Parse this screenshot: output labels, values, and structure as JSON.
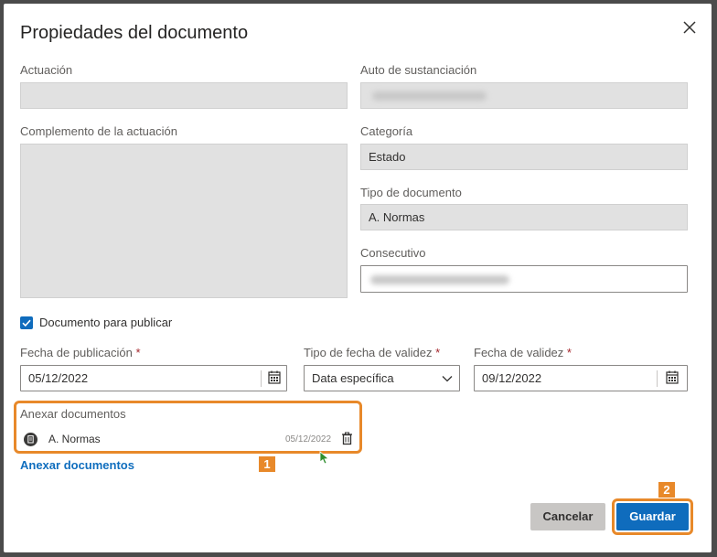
{
  "dialog": {
    "title": "Propiedades del documento"
  },
  "fields": {
    "actuacion": {
      "label": "Actuación",
      "value": ""
    },
    "auto": {
      "label": "Auto de sustanciación"
    },
    "complemento": {
      "label": "Complemento de la actuación",
      "value": ""
    },
    "categoria": {
      "label": "Categoría",
      "value": "Estado"
    },
    "tipo_documento": {
      "label": "Tipo de documento",
      "value": "A. Normas"
    },
    "consecutivo": {
      "label": "Consecutivo"
    }
  },
  "publicar": {
    "label": "Documento para publicar",
    "checked": true
  },
  "fecha_publicacion": {
    "label": "Fecha de publicación",
    "required_mark": "*",
    "value": "05/12/2022"
  },
  "tipo_fecha": {
    "label": "Tipo de fecha de validez",
    "required_mark": "*",
    "value": "Data específica"
  },
  "fecha_validez": {
    "label": "Fecha de validez",
    "required_mark": "*",
    "value": "09/12/2022"
  },
  "anexos": {
    "title": "Anexar documentos",
    "items": [
      {
        "name": "A. Normas",
        "date": "05/12/2022"
      }
    ],
    "link": "Anexar documentos"
  },
  "callouts": {
    "one": "1",
    "two": "2"
  },
  "buttons": {
    "cancel": "Cancelar",
    "save": "Guardar"
  },
  "colors": {
    "accent": "#0f6cbd",
    "highlight": "#e8892a",
    "link": "#106ebe",
    "required": "#a4262c"
  }
}
